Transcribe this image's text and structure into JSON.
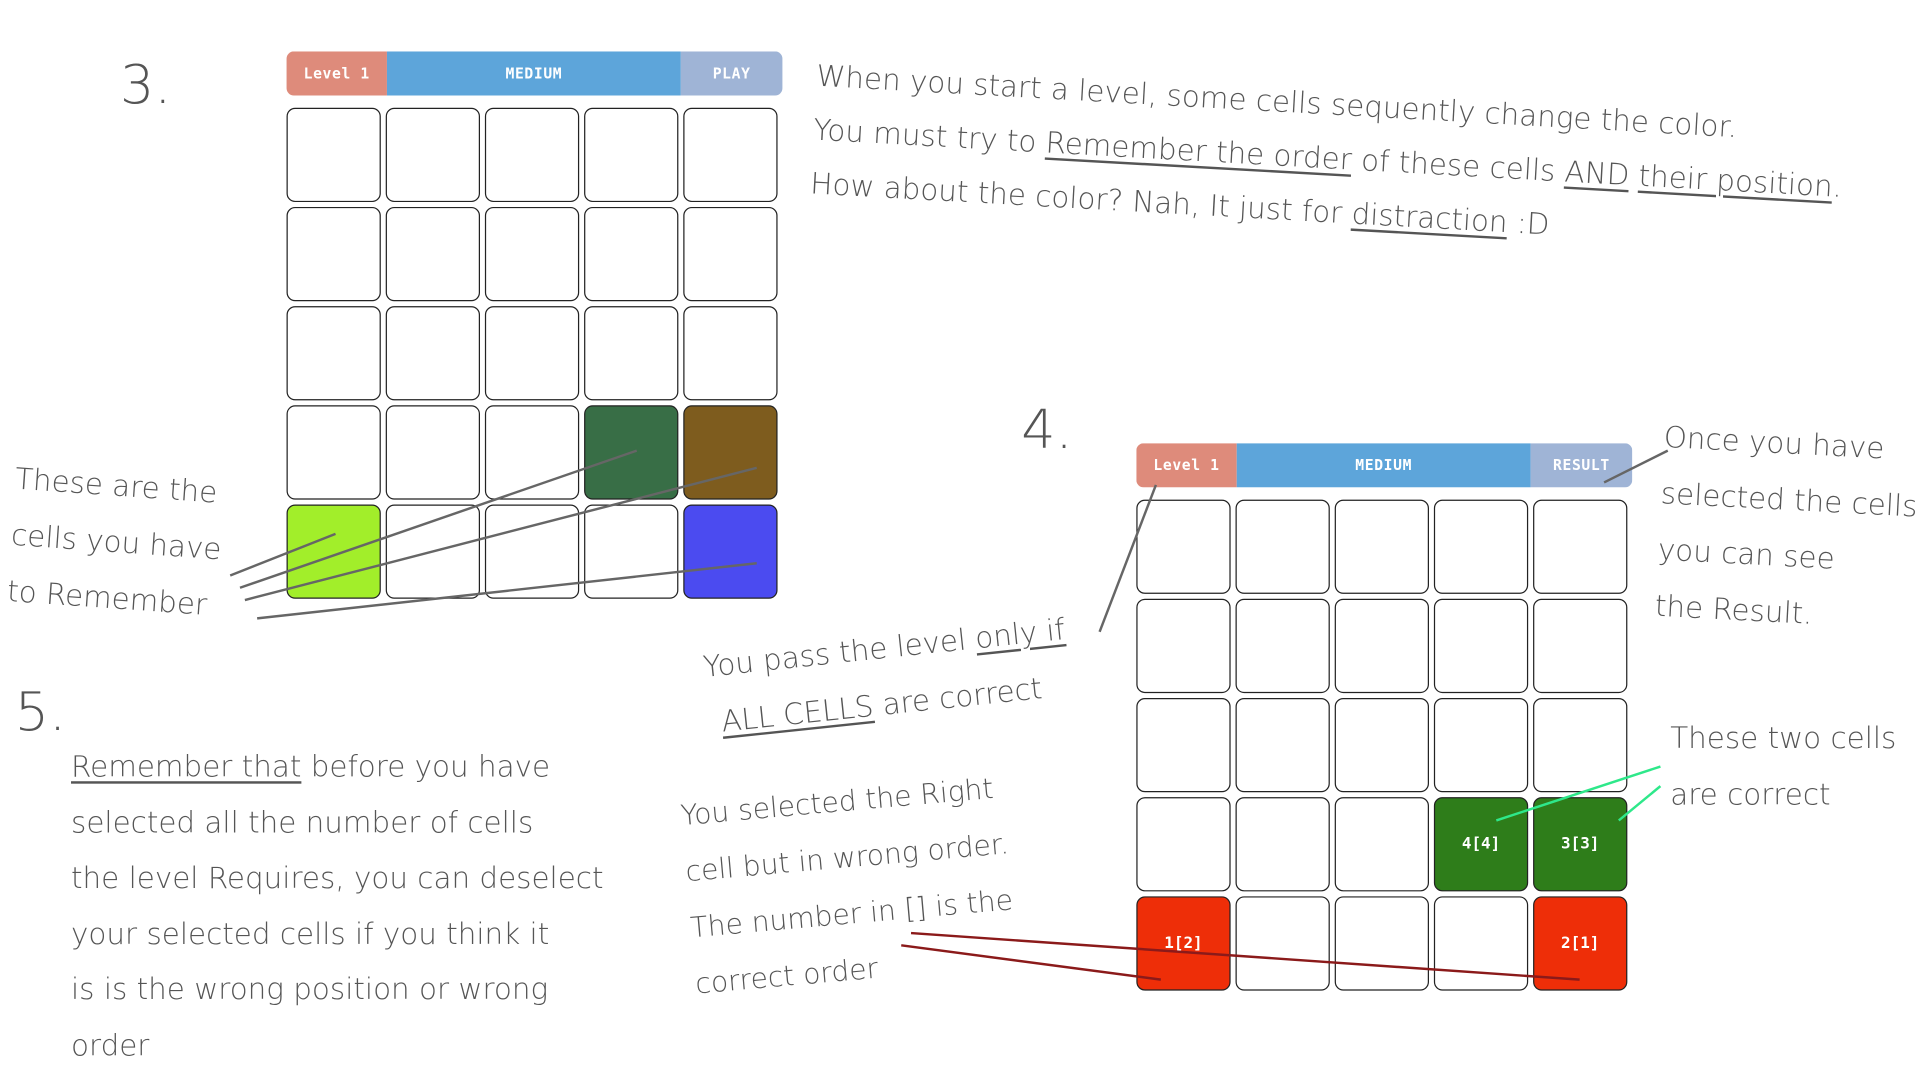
{
  "steps": {
    "three": "3.",
    "four": "4.",
    "five": "5."
  },
  "panel_top": {
    "level_label": "Level 1",
    "difficulty_label": "MEDIUM",
    "action_label": "PLAY",
    "colors": {
      "level": "#de8b7b",
      "difficulty": "#5da5da",
      "action": "#9fb4d6"
    },
    "cells": [
      {
        "color": "#ffffff",
        "text": ""
      },
      {
        "color": "#ffffff",
        "text": ""
      },
      {
        "color": "#ffffff",
        "text": ""
      },
      {
        "color": "#ffffff",
        "text": ""
      },
      {
        "color": "#ffffff",
        "text": ""
      },
      {
        "color": "#ffffff",
        "text": ""
      },
      {
        "color": "#ffffff",
        "text": ""
      },
      {
        "color": "#ffffff",
        "text": ""
      },
      {
        "color": "#ffffff",
        "text": ""
      },
      {
        "color": "#ffffff",
        "text": ""
      },
      {
        "color": "#ffffff",
        "text": ""
      },
      {
        "color": "#ffffff",
        "text": ""
      },
      {
        "color": "#ffffff",
        "text": ""
      },
      {
        "color": "#ffffff",
        "text": ""
      },
      {
        "color": "#ffffff",
        "text": ""
      },
      {
        "color": "#ffffff",
        "text": ""
      },
      {
        "color": "#ffffff",
        "text": ""
      },
      {
        "color": "#ffffff",
        "text": ""
      },
      {
        "color": "#386e46",
        "text": ""
      },
      {
        "color": "#7e5c1e",
        "text": ""
      },
      {
        "color": "#a2ee2a",
        "text": ""
      },
      {
        "color": "#ffffff",
        "text": ""
      },
      {
        "color": "#ffffff",
        "text": ""
      },
      {
        "color": "#ffffff",
        "text": ""
      },
      {
        "color": "#4b4bf0",
        "text": ""
      }
    ]
  },
  "panel_bottom": {
    "level_label": "Level 1",
    "difficulty_label": "MEDIUM",
    "action_label": "RESULT",
    "colors": {
      "level": "#de8b7b",
      "difficulty": "#5da5da",
      "action": "#9fb4d6"
    },
    "cells": [
      {
        "color": "#ffffff",
        "text": ""
      },
      {
        "color": "#ffffff",
        "text": ""
      },
      {
        "color": "#ffffff",
        "text": ""
      },
      {
        "color": "#ffffff",
        "text": ""
      },
      {
        "color": "#ffffff",
        "text": ""
      },
      {
        "color": "#ffffff",
        "text": ""
      },
      {
        "color": "#ffffff",
        "text": ""
      },
      {
        "color": "#ffffff",
        "text": ""
      },
      {
        "color": "#ffffff",
        "text": ""
      },
      {
        "color": "#ffffff",
        "text": ""
      },
      {
        "color": "#ffffff",
        "text": ""
      },
      {
        "color": "#ffffff",
        "text": ""
      },
      {
        "color": "#ffffff",
        "text": ""
      },
      {
        "color": "#ffffff",
        "text": ""
      },
      {
        "color": "#ffffff",
        "text": ""
      },
      {
        "color": "#ffffff",
        "text": ""
      },
      {
        "color": "#ffffff",
        "text": ""
      },
      {
        "color": "#ffffff",
        "text": ""
      },
      {
        "color": "#2e7d1a",
        "text": "4[4]"
      },
      {
        "color": "#2e7d1a",
        "text": "3[3]"
      },
      {
        "color": "#ee2e08",
        "text": "1[2]"
      },
      {
        "color": "#ffffff",
        "text": ""
      },
      {
        "color": "#ffffff",
        "text": ""
      },
      {
        "color": "#ffffff",
        "text": ""
      },
      {
        "color": "#ee2e08",
        "text": "2[1]"
      }
    ]
  },
  "notes": {
    "intro": {
      "line1": "When you start a level, some cells sequently change the color.",
      "line2_a": "You must try to ",
      "line2_b": "Remember the order",
      "line2_c": " of these cells ",
      "line2_d": "AND",
      "line2_e": " ",
      "line2_f": "their position",
      "line2_g": ".",
      "line3_a": "How about the color? Nah, It just for ",
      "line3_b": "distraction",
      "line3_c": " :D"
    },
    "remember": {
      "line1": "These are the",
      "line2": "cells you have",
      "line3": "to Remember"
    },
    "result": {
      "line1": "Once you have",
      "line2": "selected the cells,",
      "line3": "you can see",
      "line4": "the Result."
    },
    "pass": {
      "line1_a": "You pass the level ",
      "line1_b": "only if",
      "line2_a": "ALL CELLS",
      "line2_b": " are correct"
    },
    "correct": {
      "line1": "These two cells",
      "line2": "are correct"
    },
    "wrong_order": {
      "line1": "You selected the Right",
      "line2": "cell but in wrong order.",
      "line3": "The number in [] is the",
      "line4": "correct order"
    },
    "deselect": {
      "line1_a": "Remember that",
      "line1_b": " before you have",
      "line2": "selected all the number of cells",
      "line3": "the level Requires, you can deselect",
      "line4": "your selected cells if you think it",
      "line5": "is is the wrong position or wrong",
      "line6": "order"
    }
  },
  "line_colors": {
    "pointer_gray": "#666666",
    "pointer_green": "#2ee88a",
    "pointer_red": "#8b1a1a"
  }
}
